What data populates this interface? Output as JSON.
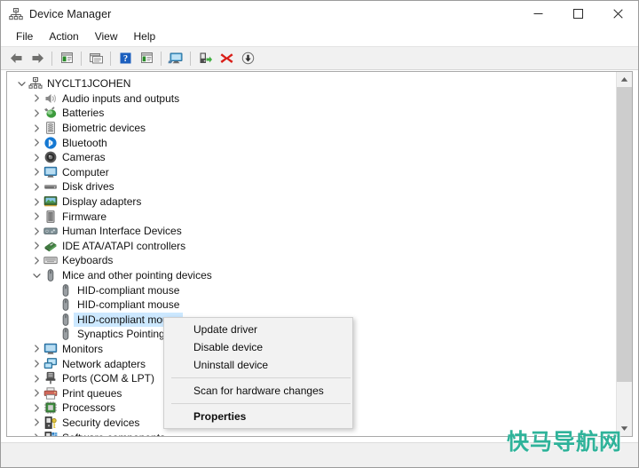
{
  "window": {
    "title": "Device Manager",
    "title_icon": "device-manager-icon",
    "minimize_label": "─",
    "maximize_label": "□",
    "close_label": "✕"
  },
  "menubar": {
    "items": [
      {
        "label": "File"
      },
      {
        "label": "Action"
      },
      {
        "label": "View"
      },
      {
        "label": "Help"
      }
    ]
  },
  "toolbar": {
    "buttons": [
      {
        "name": "back-button",
        "icon": "arrow-left-icon",
        "color": "#6d6d6d"
      },
      {
        "name": "forward-button",
        "icon": "arrow-right-icon",
        "color": "#6d6d6d"
      },
      {
        "name": "separator-1",
        "icon": "separator"
      },
      {
        "name": "show-hide-console-tree-button",
        "icon": "console-tree-icon"
      },
      {
        "name": "separator-2",
        "icon": "separator"
      },
      {
        "name": "properties-button",
        "icon": "properties-window-icon"
      },
      {
        "name": "separator-3",
        "icon": "separator"
      },
      {
        "name": "help-button",
        "icon": "help-question-icon"
      },
      {
        "name": "view-button",
        "icon": "view-list-icon"
      },
      {
        "name": "separator-4",
        "icon": "separator"
      },
      {
        "name": "scan-hardware-changes-button",
        "icon": "monitor-scan-icon"
      },
      {
        "name": "separator-5",
        "icon": "separator"
      },
      {
        "name": "update-driver-button",
        "icon": "update-driver-icon"
      },
      {
        "name": "uninstall-device-button",
        "icon": "red-x-icon"
      },
      {
        "name": "disable-device-button",
        "icon": "down-arrow-circle-icon"
      }
    ]
  },
  "tree": {
    "root": {
      "label": "NYCLT1JCOHEN",
      "icon": "computer-root-icon",
      "expanded": true
    },
    "nodes": [
      {
        "label": "Audio inputs and outputs",
        "icon": "speaker-icon",
        "indent": 1,
        "expandable": true,
        "expanded": false,
        "selected": false
      },
      {
        "label": "Batteries",
        "icon": "battery-icon",
        "indent": 1,
        "expandable": true,
        "expanded": false,
        "selected": false
      },
      {
        "label": "Biometric devices",
        "icon": "fingerprint-icon",
        "indent": 1,
        "expandable": true,
        "expanded": false,
        "selected": false
      },
      {
        "label": "Bluetooth",
        "icon": "bluetooth-icon",
        "indent": 1,
        "expandable": true,
        "expanded": false,
        "selected": false
      },
      {
        "label": "Cameras",
        "icon": "camera-icon",
        "indent": 1,
        "expandable": true,
        "expanded": false,
        "selected": false
      },
      {
        "label": "Computer",
        "icon": "monitor-icon",
        "indent": 1,
        "expandable": true,
        "expanded": false,
        "selected": false
      },
      {
        "label": "Disk drives",
        "icon": "disk-drive-icon",
        "indent": 1,
        "expandable": true,
        "expanded": false,
        "selected": false
      },
      {
        "label": "Display adapters",
        "icon": "display-adapter-icon",
        "indent": 1,
        "expandable": true,
        "expanded": false,
        "selected": false
      },
      {
        "label": "Firmware",
        "icon": "firmware-icon",
        "indent": 1,
        "expandable": true,
        "expanded": false,
        "selected": false
      },
      {
        "label": "Human Interface Devices",
        "icon": "hid-icon",
        "indent": 1,
        "expandable": true,
        "expanded": false,
        "selected": false
      },
      {
        "label": "IDE ATA/ATAPI controllers",
        "icon": "ide-controller-icon",
        "indent": 1,
        "expandable": true,
        "expanded": false,
        "selected": false
      },
      {
        "label": "Keyboards",
        "icon": "keyboard-icon",
        "indent": 1,
        "expandable": true,
        "expanded": false,
        "selected": false
      },
      {
        "label": "Mice and other pointing devices",
        "icon": "mouse-icon",
        "indent": 1,
        "expandable": true,
        "expanded": true,
        "selected": false
      },
      {
        "label": "HID-compliant mouse",
        "icon": "mouse-icon",
        "indent": 2,
        "expandable": false,
        "expanded": false,
        "selected": false
      },
      {
        "label": "HID-compliant mouse",
        "icon": "mouse-icon",
        "indent": 2,
        "expandable": false,
        "expanded": false,
        "selected": false
      },
      {
        "label": "HID-compliant mouse",
        "icon": "mouse-icon",
        "indent": 2,
        "expandable": false,
        "expanded": false,
        "selected": true
      },
      {
        "label": "Synaptics Pointing Device",
        "icon": "mouse-icon",
        "indent": 2,
        "expandable": false,
        "expanded": false,
        "selected": false
      },
      {
        "label": "Monitors",
        "icon": "monitor-icon",
        "indent": 1,
        "expandable": true,
        "expanded": false,
        "selected": false
      },
      {
        "label": "Network adapters",
        "icon": "network-adapter-icon",
        "indent": 1,
        "expandable": true,
        "expanded": false,
        "selected": false
      },
      {
        "label": "Ports (COM & LPT)",
        "icon": "port-icon",
        "indent": 1,
        "expandable": true,
        "expanded": false,
        "selected": false
      },
      {
        "label": "Print queues",
        "icon": "printer-icon",
        "indent": 1,
        "expandable": true,
        "expanded": false,
        "selected": false
      },
      {
        "label": "Processors",
        "icon": "processor-icon",
        "indent": 1,
        "expandable": true,
        "expanded": false,
        "selected": false
      },
      {
        "label": "Security devices",
        "icon": "security-device-icon",
        "indent": 1,
        "expandable": true,
        "expanded": false,
        "selected": false
      },
      {
        "label": "Software components",
        "icon": "software-component-icon",
        "indent": 1,
        "expandable": true,
        "expanded": false,
        "selected": false
      }
    ]
  },
  "context_menu": {
    "items": [
      {
        "label": "Update driver",
        "type": "item",
        "bold": false
      },
      {
        "label": "Disable device",
        "type": "item",
        "bold": false
      },
      {
        "label": "Uninstall device",
        "type": "item",
        "bold": false
      },
      {
        "label": "",
        "type": "separator",
        "bold": false
      },
      {
        "label": "Scan for hardware changes",
        "type": "item",
        "bold": false
      },
      {
        "label": "",
        "type": "separator",
        "bold": false
      },
      {
        "label": "Properties",
        "type": "item",
        "bold": true
      }
    ]
  },
  "scrollbar": {
    "up_arrow": "▲",
    "down_arrow": "▼"
  },
  "watermark": {
    "text": "快马导航网",
    "color": "#2fb39a"
  },
  "colors": {
    "selection": "#cce8ff",
    "toolbar_bg": "#f1f1f1",
    "menu_bg": "#f2f2f2",
    "accent": "#2fb39a"
  }
}
